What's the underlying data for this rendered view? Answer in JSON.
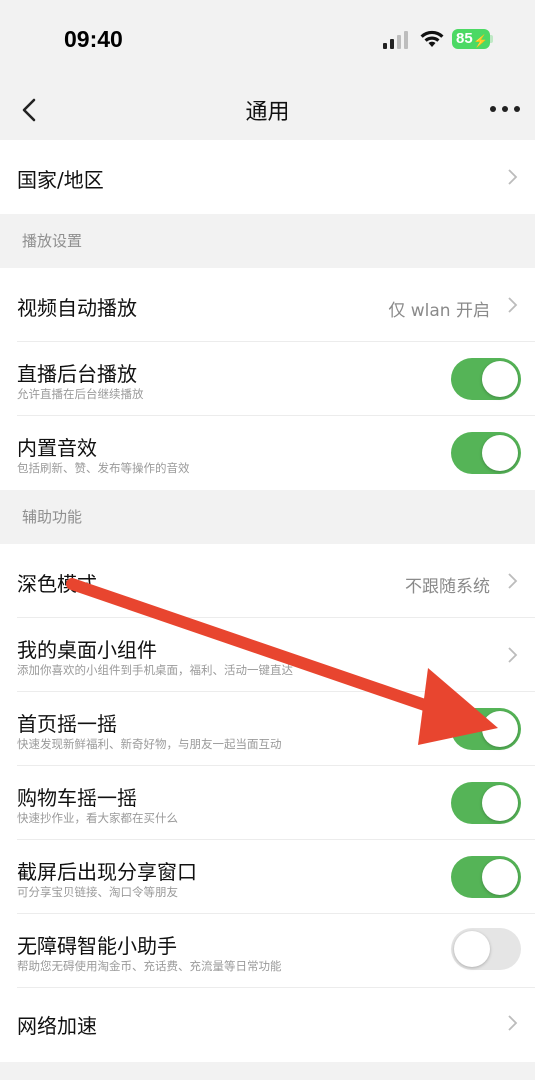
{
  "status_bar": {
    "time": "09:40",
    "battery_level": "85",
    "icons": [
      "signal-icon",
      "wifi-icon",
      "battery-icon"
    ]
  },
  "nav": {
    "title": "通用",
    "back_icon": "chevron-left-icon",
    "more_icon": "more-dots-icon"
  },
  "rows": {
    "region": {
      "title": "国家/地区"
    },
    "video_autoplay": {
      "title": "视频自动播放",
      "value": "仅 wlan 开启"
    },
    "live_background": {
      "title": "直播后台播放",
      "subtitle": "允许直播在后台继续播放",
      "enabled": true
    },
    "sound_effects": {
      "title": "内置音效",
      "subtitle": "包括刷新、赞、发布等操作的音效",
      "enabled": true
    },
    "dark_mode": {
      "title": "深色模式",
      "value": "不跟随系统"
    },
    "desktop_widget": {
      "title": "我的桌面小组件",
      "subtitle": "添加你喜欢的小组件到手机桌面，福利、活动一键直达"
    },
    "home_shake": {
      "title": "首页摇一摇",
      "subtitle": "快速发现新鲜福利、新奇好物，与朋友一起当面互动",
      "enabled": true
    },
    "cart_shake": {
      "title": "购物车摇一摇",
      "subtitle": "快速抄作业，看大家都在买什么",
      "enabled": true
    },
    "screenshot_share": {
      "title": "截屏后出现分享窗口",
      "subtitle": "可分享宝贝链接、淘口令等朋友",
      "enabled": true
    },
    "accessibility_assistant": {
      "title": "无障碍智能小助手",
      "subtitle": "帮助您无碍使用淘金币、充话费、充流量等日常功能",
      "enabled": false
    },
    "network_boost": {
      "title": "网络加速"
    }
  },
  "sections": {
    "playback": "播放设置",
    "accessibility": "辅助功能"
  },
  "colors": {
    "toggle_on": "#55b457",
    "toggle_off": "#e5e5e5",
    "annotation_arrow": "#e8452f",
    "background": "#f2f2f2"
  }
}
